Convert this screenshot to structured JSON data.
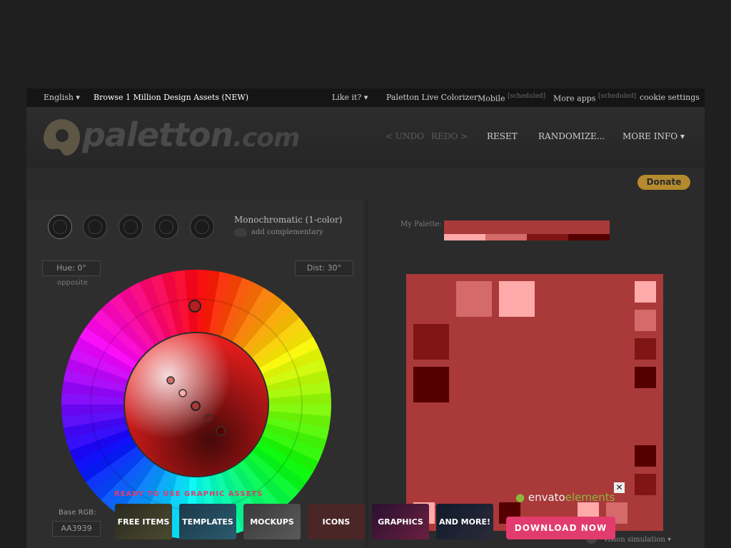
{
  "topnav": {
    "language": "English",
    "browse": "Browse 1 Million Design Assets (NEW)",
    "like": "Like it?",
    "live_colorizer": "Paletton Live Colorizer",
    "mobile": "Mobile",
    "scheduled1": "[scheduled]",
    "more_apps": "More apps",
    "scheduled2": "[scheduled]",
    "cookie": "cookie settings"
  },
  "header": {
    "logo_main": "paletton",
    "logo_suffix": ".com",
    "undo": "< UNDO",
    "redo": "REDO >",
    "reset": "RESET",
    "randomize": "RANDOMIZE...",
    "more_info": "MORE INFO"
  },
  "donate": "Donate",
  "scheme": {
    "name": "Monochromatic (1-color)",
    "add_complementary": "add complementary"
  },
  "hue": "Hue: 0°",
  "opposite": "opposite",
  "dist": "Dist: 30°",
  "base_rgb_label": "Base RGB:",
  "base_rgb_value": "AA3939",
  "my_palette_label": "My Palette:",
  "palette_colors": {
    "base": "#AA3939",
    "light2": "#FFAAAA",
    "light1": "#D46A6A",
    "dark1": "#801515",
    "dark2": "#550000"
  },
  "vision": "vision simulation",
  "ad": {
    "ready": "READY TO USE GRAPHIC ASSETS",
    "free_items": "FREE ITEMS",
    "templates": "TEMPLATES",
    "mockups": "MOCKUPS",
    "icons": "ICONS",
    "graphics": "GRAPHICS",
    "and_more": "AND MORE!",
    "envato": "envato",
    "elements": "elements",
    "download": "DOWNLOAD NOW"
  }
}
